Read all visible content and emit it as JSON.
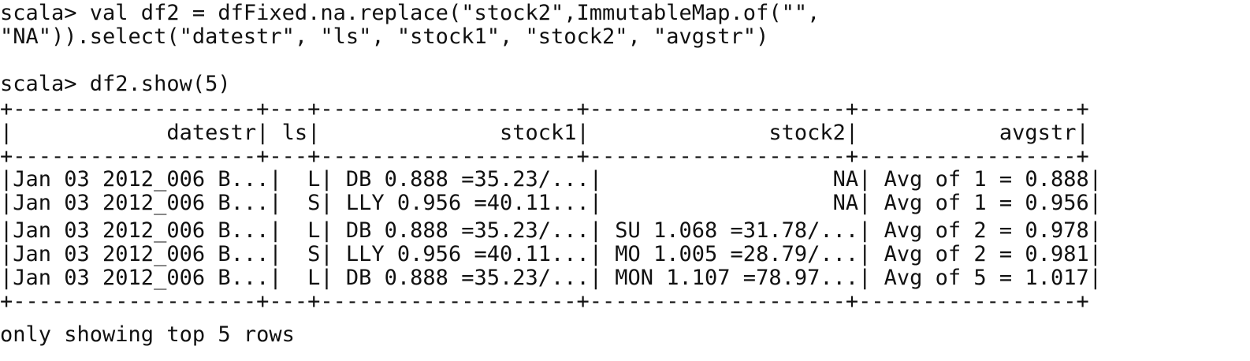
{
  "command": {
    "line1": "scala> val df2 = dfFixed.na.replace(\"stock2\",ImmutableMap.of(\"\",",
    "line2": "\"NA\")).select(\"datestr\", \"ls\", \"stock1\", \"stock2\", \"avgstr\")"
  },
  "show_command": "scala> df2.show(5)",
  "table": {
    "border": "+-------------------+---+--------------------+--------------------+-----------------+",
    "header": "|            datestr| ls|              stock1|              stock2|           avgstr|",
    "rows": [
      "|Jan 03 2012_006 B...|  L| DB 0.888 =35.23/...|                  NA| Avg of 1 = 0.888|",
      "|Jan 03 2012_006 B...|  S| LLY 0.956 =40.11...|                  NA| Avg of 1 = 0.956|",
      "|Jan 03 2012_006 B...|  L| DB 0.888 =35.23/...| SU 1.068 =31.78/...| Avg of 2 = 0.978|",
      "|Jan 03 2012_006 B...|  S| LLY 0.956 =40.11...| MO 1.005 =28.79/...| Avg of 2 = 0.981|",
      "|Jan 03 2012_006 B...|  L| DB 0.888 =35.23/...| MON 1.107 =78.97...| Avg of 5 = 1.017|"
    ]
  },
  "footer": "only showing top 5 rows"
}
